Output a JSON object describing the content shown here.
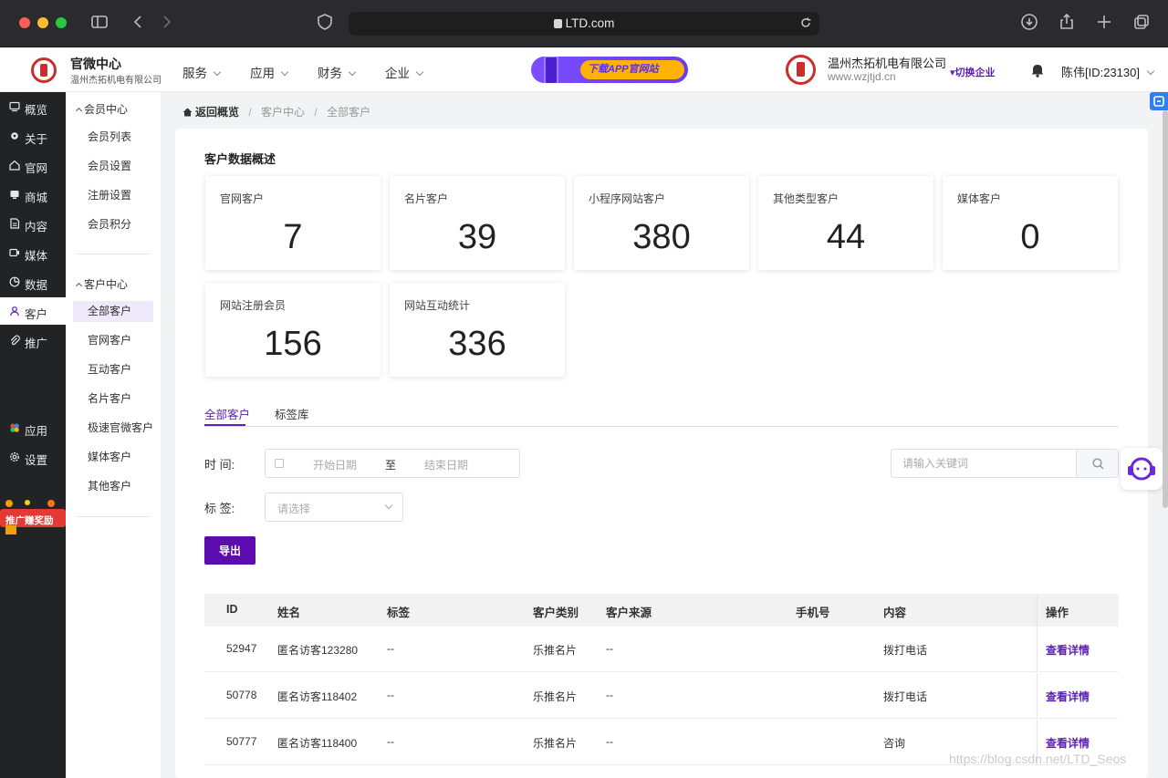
{
  "browser": {
    "url": "LTD.com"
  },
  "header": {
    "brand_title": "官微中心",
    "brand_subtitle": "温州杰拓机电有限公司",
    "nav": [
      {
        "label": "服务"
      },
      {
        "label": "应用"
      },
      {
        "label": "财务"
      },
      {
        "label": "企业"
      }
    ],
    "banner_text": "下载APP官网站",
    "company_name": "温州杰拓机电有限公司",
    "company_url": "www.wzjtjd.cn",
    "switch_label": "▾切换企业",
    "user": "陈伟[ID:23130]"
  },
  "rail": {
    "items": [
      {
        "label": "概览",
        "icon": "overview-icon"
      },
      {
        "label": "关于",
        "icon": "gear-icon"
      },
      {
        "label": "官网",
        "icon": "home-icon"
      },
      {
        "label": "商城",
        "icon": "shop-icon"
      },
      {
        "label": "内容",
        "icon": "document-icon"
      },
      {
        "label": "媒体",
        "icon": "media-icon"
      },
      {
        "label": "数据",
        "icon": "chart-icon"
      },
      {
        "label": "客户",
        "icon": "user-icon"
      },
      {
        "label": "推广",
        "icon": "paperclip-icon"
      },
      {
        "label": "应用",
        "icon": "apps-icon"
      },
      {
        "label": "设置",
        "icon": "settings-icon"
      }
    ],
    "promo_label": "推广赚奖励"
  },
  "sidebar": {
    "group1": {
      "title": "会员中心",
      "items": [
        "会员列表",
        "会员设置",
        "注册设置",
        "会员积分"
      ]
    },
    "group2": {
      "title": "客户中心",
      "items": [
        "全部客户",
        "官网客户",
        "互动客户",
        "名片客户",
        "极速官微客户",
        "媒体客户",
        "其他客户"
      ]
    }
  },
  "breadcrumb": {
    "home": "返回概览",
    "level1": "客户中心",
    "level2": "全部客户"
  },
  "overview": {
    "title": "客户数据概述",
    "stats": [
      {
        "label": "官网客户",
        "value": "7"
      },
      {
        "label": "名片客户",
        "value": "39"
      },
      {
        "label": "小程序网站客户",
        "value": "380"
      },
      {
        "label": "其他类型客户",
        "value": "44"
      },
      {
        "label": "媒体客户",
        "value": "0"
      },
      {
        "label": "网站注册会员",
        "value": "156"
      },
      {
        "label": "网站互动统计",
        "value": "336"
      }
    ]
  },
  "tabs": [
    {
      "label": "全部客户",
      "active": true
    },
    {
      "label": "标签库",
      "active": false
    }
  ],
  "filters": {
    "time_label": "时  间:",
    "start_placeholder": "开始日期",
    "to": "至",
    "end_placeholder": "结束日期",
    "tag_label": "标  签:",
    "tag_placeholder": "请选择",
    "search_placeholder": "请输入关键词",
    "export_label": "导出"
  },
  "table": {
    "columns": [
      "ID",
      "姓名",
      "标签",
      "客户类别",
      "客户来源",
      "手机号",
      "内容",
      "操作"
    ],
    "rows": [
      {
        "id": "52947",
        "name": "匿名访客123280",
        "tag": "--",
        "category": "乐推名片",
        "source": "--",
        "phone": "",
        "content": "拨打电话",
        "action": "查看详情"
      },
      {
        "id": "50778",
        "name": "匿名访客118402",
        "tag": "--",
        "category": "乐推名片",
        "source": "--",
        "phone": "",
        "content": "拨打电话",
        "action": "查看详情"
      },
      {
        "id": "50777",
        "name": "匿名访客118400",
        "tag": "--",
        "category": "乐推名片",
        "source": "--",
        "phone": "",
        "content": "咨询",
        "action": "查看详情"
      }
    ]
  },
  "watermark": "https://blog.csdn.net/LTD_Seos",
  "colors": {
    "accent": "#5b0bb0",
    "rail_bg": "#222325",
    "banner_pill": "#ffb300"
  }
}
